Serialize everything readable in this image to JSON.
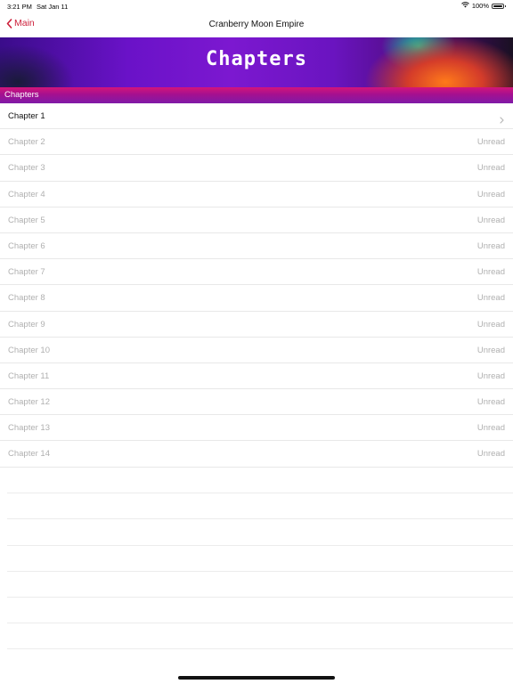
{
  "status_bar": {
    "time": "3:21 PM",
    "date": "Sat Jan 11",
    "battery": "100%"
  },
  "nav": {
    "back_label": "Main",
    "title": "Cranberry Moon Empire",
    "accent_color": "#cc1f3a"
  },
  "banner": {
    "title": "Chapters"
  },
  "section": {
    "header": "Chapters"
  },
  "chapters": [
    {
      "label": "Chapter 1",
      "status": ""
    },
    {
      "label": "Chapter 2",
      "status": "Unread"
    },
    {
      "label": "Chapter 3",
      "status": "Unread"
    },
    {
      "label": "Chapter 4",
      "status": "Unread"
    },
    {
      "label": "Chapter 5",
      "status": "Unread"
    },
    {
      "label": "Chapter 6",
      "status": "Unread"
    },
    {
      "label": "Chapter 7",
      "status": "Unread"
    },
    {
      "label": "Chapter 8",
      "status": "Unread"
    },
    {
      "label": "Chapter 9",
      "status": "Unread"
    },
    {
      "label": "Chapter 10",
      "status": "Unread"
    },
    {
      "label": "Chapter 11",
      "status": "Unread"
    },
    {
      "label": "Chapter 12",
      "status": "Unread"
    },
    {
      "label": "Chapter 13",
      "status": "Unread"
    },
    {
      "label": "Chapter 14",
      "status": "Unread"
    }
  ]
}
